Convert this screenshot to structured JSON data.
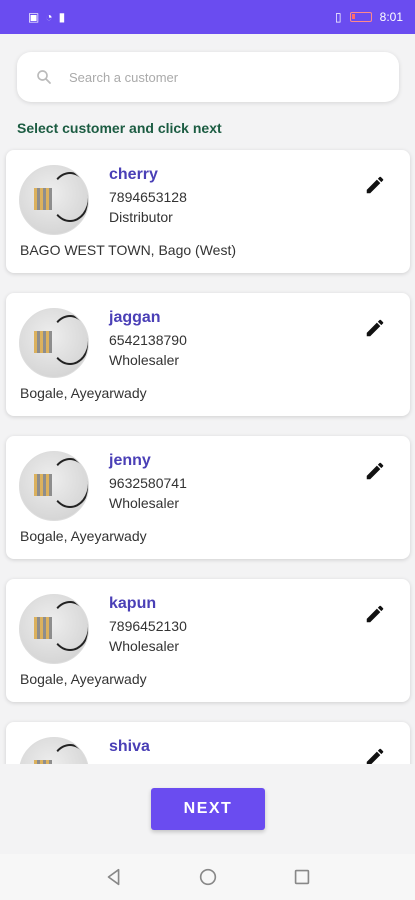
{
  "status": {
    "time": "8:01"
  },
  "search": {
    "placeholder": "Search a customer"
  },
  "hint": "Select customer and click next",
  "customers": [
    {
      "name": "cherry",
      "phone": "7894653128",
      "type": "Distributor",
      "address": "BAGO WEST TOWN, Bago (West)"
    },
    {
      "name": "jaggan",
      "phone": "6542138790",
      "type": "Wholesaler",
      "address": "Bogale, Ayeyarwady"
    },
    {
      "name": "jenny",
      "phone": "9632580741",
      "type": "Wholesaler",
      "address": "Bogale, Ayeyarwady"
    },
    {
      "name": "kapun",
      "phone": "7896452130",
      "type": "Wholesaler",
      "address": "Bogale, Ayeyarwady"
    },
    {
      "name": "shiva",
      "phone": "",
      "type": "",
      "address": ""
    }
  ],
  "next_label": "NEXT",
  "colors": {
    "accent": "#6a4cf0",
    "name": "#4a3fb6",
    "hint": "#1c5c42"
  },
  "icons": {
    "search": "search-icon",
    "edit": "pencil-icon",
    "back": "back-triangle-icon",
    "home": "home-circle-icon",
    "recents": "recents-square-icon"
  }
}
